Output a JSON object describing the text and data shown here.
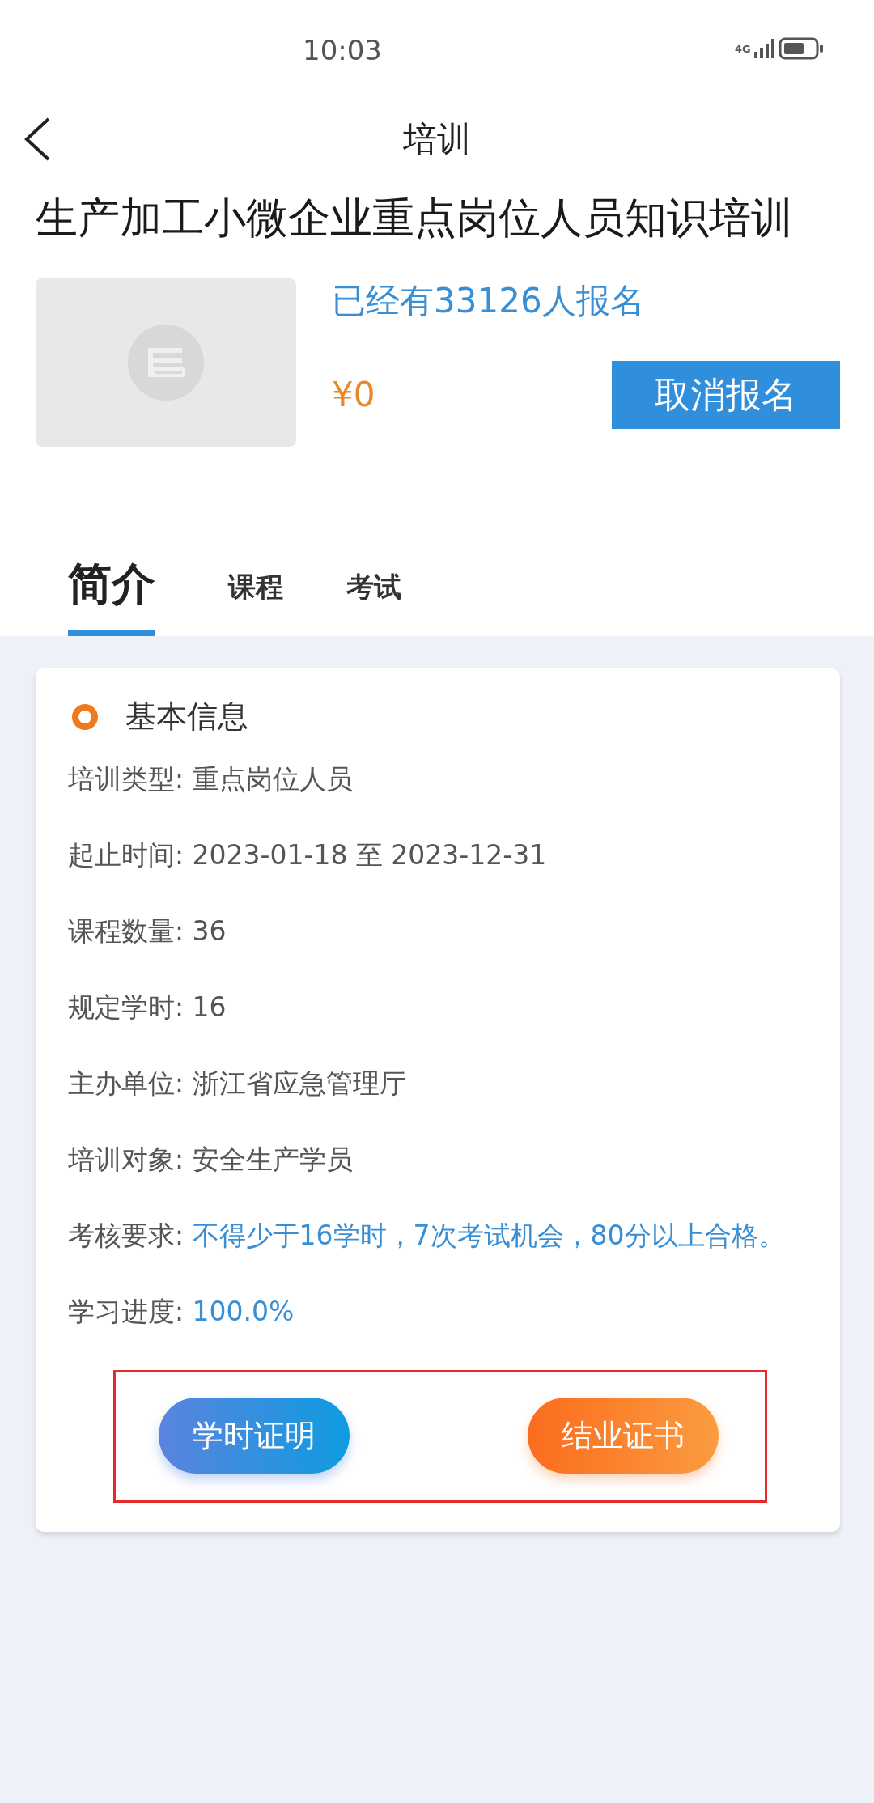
{
  "status_bar": {
    "time": "10:03",
    "network": "4G"
  },
  "nav": {
    "title": "培训"
  },
  "course": {
    "title": "生产加工小微企业重点岗位人员知识培训",
    "enrolled": "已经有33126人报名",
    "price": "¥0",
    "action": "取消报名"
  },
  "tabs": [
    {
      "label": "简介",
      "selected": true
    },
    {
      "label": "课程",
      "selected": false
    },
    {
      "label": "考试",
      "selected": false
    }
  ],
  "info": {
    "heading": "基本信息",
    "fields": [
      {
        "label": "培训类型:",
        "value": "重点岗位人员",
        "kind": "plain"
      },
      {
        "label": "起止时间:",
        "value": "2023-01-18 至 2023-12-31",
        "kind": "plain"
      },
      {
        "label": "课程数量:",
        "value": "36",
        "kind": "plain"
      },
      {
        "label": "规定学时:",
        "value": "16",
        "kind": "plain"
      },
      {
        "label": "主办单位:",
        "value": "浙江省应急管理厅",
        "kind": "plain"
      },
      {
        "label": "培训对象:",
        "value": "安全生产学员",
        "kind": "plain"
      },
      {
        "label": "考核要求:",
        "value": "不得少于16学时，7次考试机会，80分以上合格。",
        "kind": "highlight"
      },
      {
        "label": "学习进度:",
        "value": "100.0%",
        "kind": "highlight"
      }
    ]
  },
  "actions": {
    "outlined": true,
    "buttons": [
      {
        "label": "学时证明",
        "kind": "hours"
      },
      {
        "label": "结业证书",
        "kind": "certificate"
      }
    ]
  }
}
